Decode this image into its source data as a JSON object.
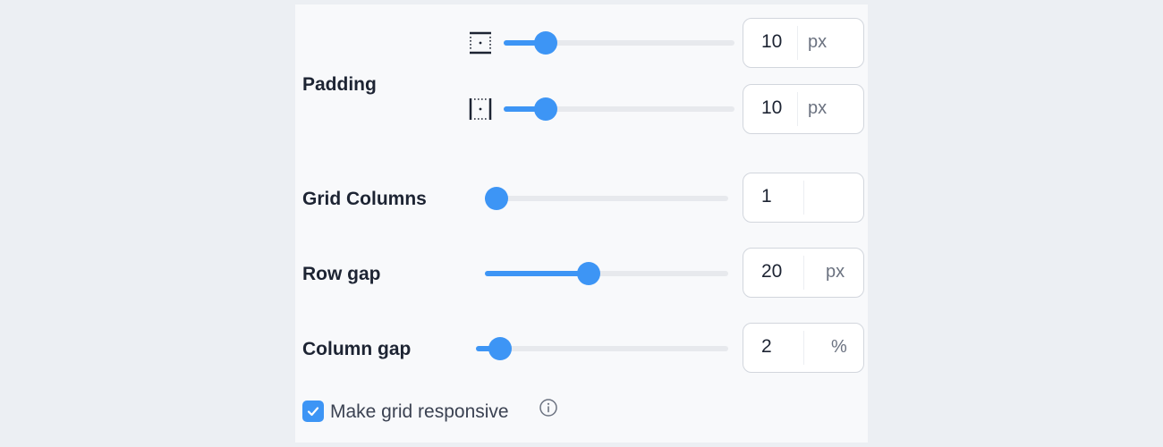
{
  "padding": {
    "label": "Padding",
    "vertical": {
      "icon": "padding-vertical-icon",
      "value": "10",
      "unit": "px",
      "level": 0.13
    },
    "horizontal": {
      "icon": "padding-horizontal-icon",
      "value": "10",
      "unit": "px",
      "level": 0.13
    }
  },
  "grid_columns": {
    "label": "Grid Columns",
    "value": "1",
    "unit": "",
    "level": 0.0
  },
  "row_gap": {
    "label": "Row gap",
    "value": "20",
    "unit": "px",
    "level": 0.38
  },
  "column_gap": {
    "label": "Column gap",
    "value": "2",
    "unit": "%",
    "level": 0.05
  },
  "responsive": {
    "label": "Make grid responsive",
    "checked": true,
    "info_icon": "info-icon"
  },
  "colors": {
    "accent": "#3d95f5",
    "track": "#e7e9ed",
    "panel": "#f8f9fb",
    "page": "#eceff3"
  }
}
